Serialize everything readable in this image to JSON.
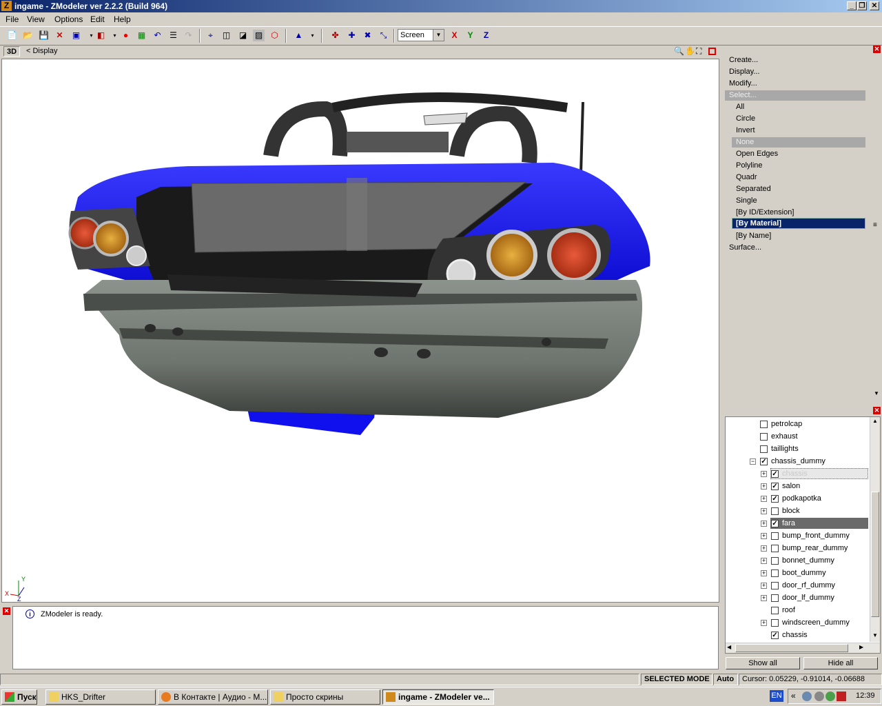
{
  "window": {
    "app_icon": "Z",
    "title": "ingame - ZModeler ver 2.2.2 (Build 964)"
  },
  "menu": [
    "File",
    "View",
    "Options",
    "Edit",
    "Help"
  ],
  "toolbar": {
    "screen_value": "Screen",
    "axis_x": "X",
    "axis_y": "Y",
    "axis_z": "Z"
  },
  "viewport": {
    "mode": "3D",
    "breadcrumb": "< Display"
  },
  "commands": {
    "items": [
      "Create...",
      "Display...",
      "Modify...",
      "Select..."
    ],
    "select_items": [
      "All",
      "Circle",
      "Invert",
      "None",
      "Open Edges",
      "Polyline",
      "Quadr",
      "Separated",
      "Single",
      "[By ID/Extension]",
      "[By Material]",
      "[By Name]"
    ],
    "surface": "Surface..."
  },
  "tree": {
    "rows": [
      {
        "label": "petrolcap",
        "checked": false,
        "expander": false,
        "indent": 1
      },
      {
        "label": "exhaust",
        "checked": false,
        "expander": false,
        "indent": 1
      },
      {
        "label": "taillights",
        "checked": false,
        "expander": false,
        "indent": 1
      },
      {
        "label": "chassis_dummy",
        "checked": true,
        "expander": "minus",
        "indent": 0
      },
      {
        "label": "chassis",
        "checked": true,
        "expander": "plus",
        "indent": 2,
        "state": "selected-light"
      },
      {
        "label": "salon",
        "checked": true,
        "expander": "plus",
        "indent": 2
      },
      {
        "label": "podkapotka",
        "checked": true,
        "expander": "plus",
        "indent": 2
      },
      {
        "label": "block",
        "checked": false,
        "expander": "plus",
        "indent": 2
      },
      {
        "label": "fara",
        "checked": true,
        "expander": "plus",
        "indent": 2,
        "state": "selected-dark"
      },
      {
        "label": "bump_front_dummy",
        "checked": false,
        "expander": "plus",
        "indent": 2
      },
      {
        "label": "bump_rear_dummy",
        "checked": false,
        "expander": "plus",
        "indent": 2
      },
      {
        "label": "bonnet_dummy",
        "checked": false,
        "expander": "plus",
        "indent": 2
      },
      {
        "label": "boot_dummy",
        "checked": false,
        "expander": "plus",
        "indent": 2
      },
      {
        "label": "door_rf_dummy",
        "checked": false,
        "expander": "plus",
        "indent": 2
      },
      {
        "label": "door_lf_dummy",
        "checked": false,
        "expander": "plus",
        "indent": 2
      },
      {
        "label": "roof",
        "checked": false,
        "expander": false,
        "indent": 2
      },
      {
        "label": "windscreen_dummy",
        "checked": false,
        "expander": "plus",
        "indent": 2
      },
      {
        "label": "chassis",
        "checked": true,
        "expander": false,
        "indent": 2
      }
    ],
    "show_all": "Show all",
    "hide_all": "Hide all"
  },
  "log": {
    "message": "ZModeler is ready."
  },
  "status": {
    "mode": "SELECTED MODE",
    "auto": "Auto",
    "cursor": "Cursor: 0.05229, -0.91014, -0.06688"
  },
  "taskbar": {
    "start": "Пуск",
    "tasks": [
      "HKS_Drifter",
      "В Контакте | Аудио - М...",
      "Просто скрины",
      "ingame - ZModeler ve..."
    ],
    "lang": "EN",
    "clock": "12:39"
  },
  "colors": {
    "car_body": "#1414e6",
    "selection": "#0a246a"
  }
}
